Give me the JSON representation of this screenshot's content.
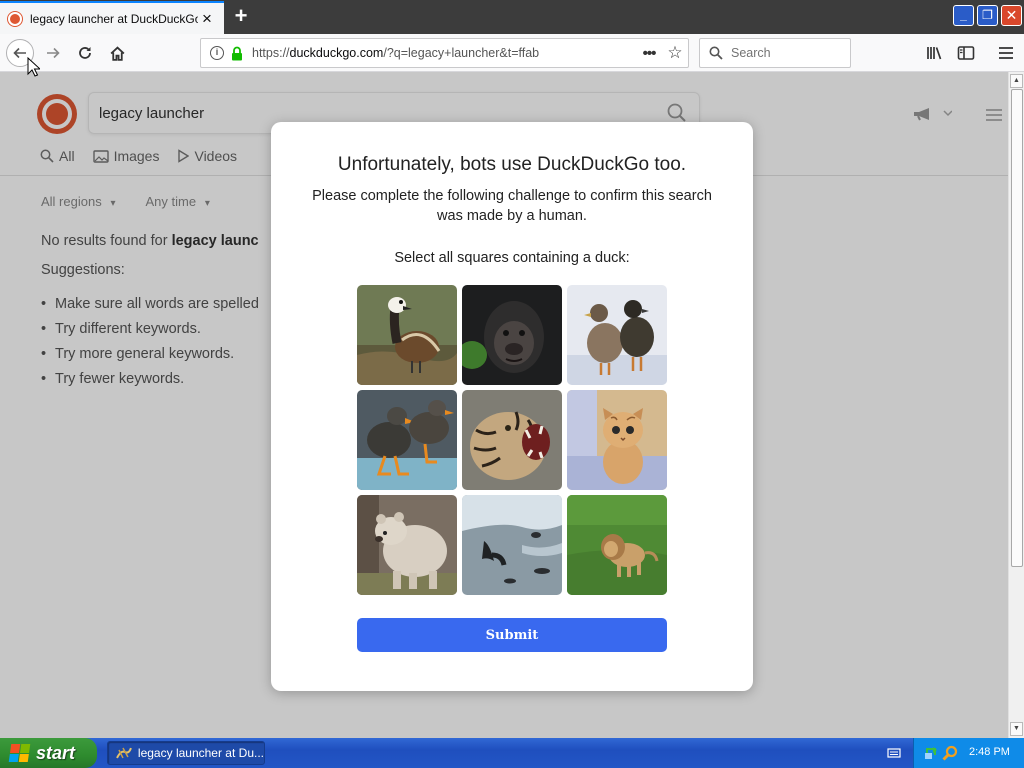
{
  "browser": {
    "tab_title": "legacy launcher at DuckDuckGo",
    "tab_close": "×",
    "new_tab": "+",
    "url_scheme": "https://",
    "url_host": "duckduckgo.com",
    "url_path": "/?q=legacy+launcher&t=ffab",
    "search_placeholder": "Search",
    "window_controls": {
      "minimize": "_",
      "maximize": "❐",
      "close": "✕"
    }
  },
  "page": {
    "search_value": "legacy launcher",
    "tabs": [
      "All",
      "Images",
      "Videos"
    ],
    "filters": [
      "All regions",
      "Any time"
    ],
    "noresults_prefix": "No results found for ",
    "noresults_query": "legacy launc",
    "suggestions_title": "Suggestions:",
    "suggestions": [
      "Make sure all words are spelled",
      "Try different keywords.",
      "Try more general keywords.",
      "Try fewer keywords."
    ]
  },
  "modal": {
    "title": "Unfortunately, bots use DuckDuckGo too.",
    "description": "Please complete the following challenge to confirm this search was made by a human.",
    "instruction": "Select all squares containing a duck:",
    "submit_label": "Submit",
    "tiles": [
      {
        "subject": "duck"
      },
      {
        "subject": "gorilla"
      },
      {
        "subject": "ducks"
      },
      {
        "subject": "ducks"
      },
      {
        "subject": "tiger"
      },
      {
        "subject": "kitten"
      },
      {
        "subject": "bear"
      },
      {
        "subject": "seals"
      },
      {
        "subject": "lion"
      }
    ]
  },
  "taskbar": {
    "start_label": "start",
    "task_label": "legacy launcher at Du...",
    "clock": "2:48 PM"
  },
  "colors": {
    "accent": "#0a84ff",
    "ddg_orange": "#de5833",
    "submit_blue": "#3969ef"
  }
}
